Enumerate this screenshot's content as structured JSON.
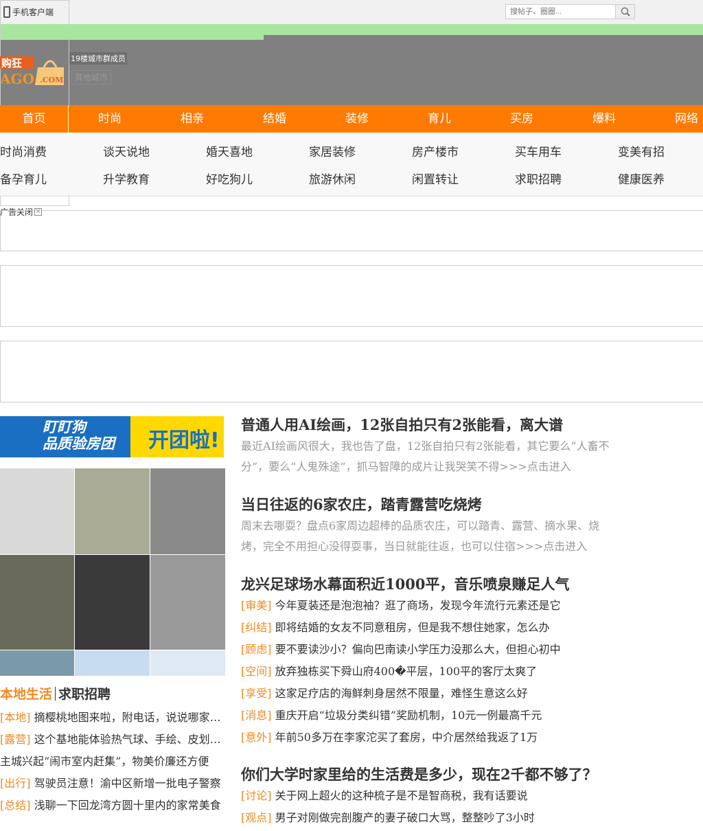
{
  "top": {
    "mobile_client": "手机客户端",
    "search_placeholder": "搜帖子、圈圈..."
  },
  "header": {
    "city_group": "19楼城市群成员",
    "other_city": "其他城市"
  },
  "nav": [
    "首页",
    "时尚",
    "相亲",
    "结婚",
    "装修",
    "育儿",
    "买房",
    "爆料",
    "网络"
  ],
  "subnav": [
    [
      "时尚消费",
      "谈天说地",
      "婚天喜地",
      "家居装修",
      "房产楼市",
      "买车用车",
      "变美有招"
    ],
    [
      "备孕育儿",
      "升学教育",
      "好吃狗儿",
      "旅游休闲",
      "闲置转让",
      "求职招聘",
      "健康医养"
    ]
  ],
  "ad": {
    "close": "广告关闭"
  },
  "banner": {
    "line1": "盯盯狗",
    "line2": "品质验房团",
    "cta": "开团啦!"
  },
  "left": {
    "tab_active": "本地生活",
    "tab_other": "求职招聘",
    "items": [
      {
        "tag": "[本地]",
        "text": "摘樱桃地图来啦，附电话，说说哪家樱桃最好吃"
      },
      {
        "tag": "[露营]",
        "text": "这个基地能体验热气球、手绘、皮划艇等项目"
      },
      {
        "tag": "",
        "text": "主城兴起“闹市室内赶集”，物美价廉还方便"
      },
      {
        "tag": "[出行]",
        "text": "驾驶员注意！渝中区新增一批电子警察"
      },
      {
        "tag": "[总结]",
        "text": "浅聊一下回龙湾方圆十里内的家常美食"
      }
    ]
  },
  "articles": [
    {
      "title": "普通人用AI绘画，12张自拍只有2张能看，离大谱",
      "summary": "最近AI绘画风很大，我也告了盘，12张自拍只有2张能看，其它要么“人畜不分”，要么“人鬼殊途”，抓马智障的成片让我哭笑不得",
      "more": ">>>点击进入"
    },
    {
      "title": "当日往返的6家农庄，踏青露营吃烧烤",
      "summary": "周末去哪耍？盘点6家周边超棒的品质农庄，可以踏青、露营、摘水果、烧烤，完全不用担心没得耍事，当日就能往返，也可以住宿",
      "more": ">>>点击进入"
    },
    {
      "title": "龙兴足球场水幕面积近1000平，音乐喷泉赚足人气",
      "items": [
        {
          "tag": "[审美]",
          "text": "今年夏装还是泡泡袖？逛了商场，发现今年流行元素还是它"
        },
        {
          "tag": "[纠结]",
          "text": "即将结婚的女友不同意租房，但是我不想住她家，怎么办"
        },
        {
          "tag": "[顾虑]",
          "text": "要不要读沙小？偏向巴南读小学压力没那么大，但担心初中"
        },
        {
          "tag": "[空间]",
          "text": "放弃独栋买下舜山府400�平层，100平的客厅太爽了"
        },
        {
          "tag": "[享受]",
          "text": "这家足疗店的海鲜刺身居然不限量，难怪生意这么好"
        },
        {
          "tag": "[消息]",
          "text": "重庆开启“垃圾分类纠错”奖励机制，10元一例最高千元"
        },
        {
          "tag": "[意外]",
          "text": "年前50多万在李家沱买了套房，中介居然给我返了1万"
        }
      ]
    },
    {
      "title": "你们大学时家里给的生活费是多少，现在2千都不够了？",
      "items": [
        {
          "tag": "[讨论]",
          "text": "关于网上超火的这种梳子是不是智商税，我有话要说"
        },
        {
          "tag": "[观点]",
          "text": "男子对刚做完剖腹产的妻子破口大骂，整整吵了3小时"
        }
      ]
    }
  ]
}
